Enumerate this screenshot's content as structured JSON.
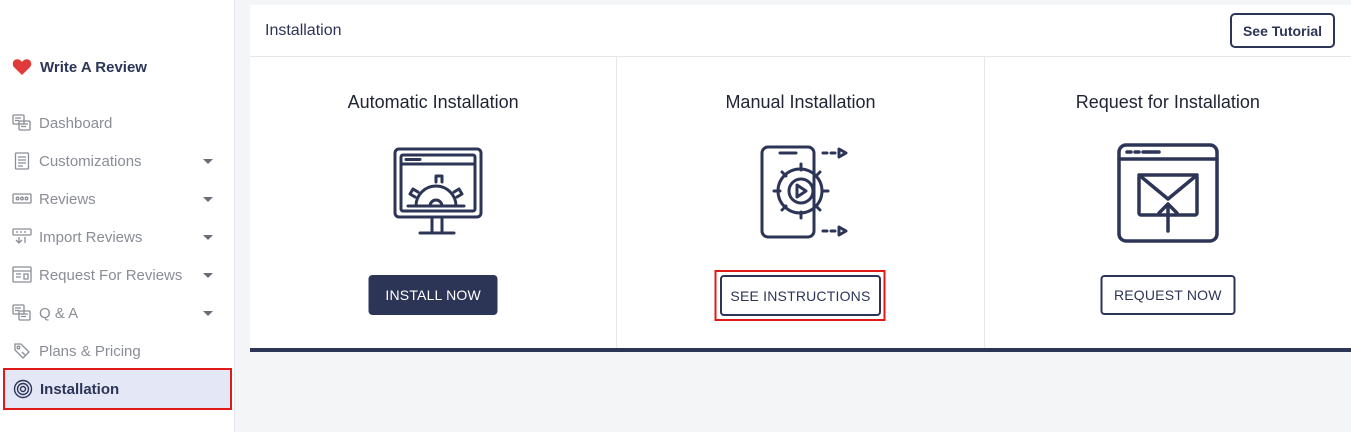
{
  "sidebar": {
    "brand": "Write A Review",
    "items": [
      {
        "label": "Dashboard",
        "icon": "dashboard-icon",
        "has_caret": false
      },
      {
        "label": "Customizations",
        "icon": "document-icon",
        "has_caret": true
      },
      {
        "label": "Reviews",
        "icon": "reviews-icon",
        "has_caret": true
      },
      {
        "label": "Import Reviews",
        "icon": "import-icon",
        "has_caret": true
      },
      {
        "label": "Request For Reviews",
        "icon": "request-icon",
        "has_caret": true
      },
      {
        "label": "Q & A",
        "icon": "qa-icon",
        "has_caret": true
      },
      {
        "label": "Plans & Pricing",
        "icon": "tag-icon",
        "has_caret": false
      },
      {
        "label": "Installation",
        "icon": "installation-icon",
        "has_caret": false,
        "active": true
      }
    ]
  },
  "header": {
    "title": "Installation",
    "tutorial_label": "See Tutorial"
  },
  "cards": [
    {
      "title": "Automatic Installation",
      "button": "INSTALL NOW",
      "icon": "monitor-gear-icon"
    },
    {
      "title": "Manual Installation",
      "button": "SEE INSTRUCTIONS",
      "icon": "phone-gear-play-icon"
    },
    {
      "title": "Request for Installation",
      "button": "REQUEST NOW",
      "icon": "browser-mail-upload-icon"
    }
  ],
  "colors": {
    "primary": "#2d3557",
    "highlight": "#e01919",
    "active_bg": "#e3e7f6",
    "heart": "#e03a3a"
  }
}
